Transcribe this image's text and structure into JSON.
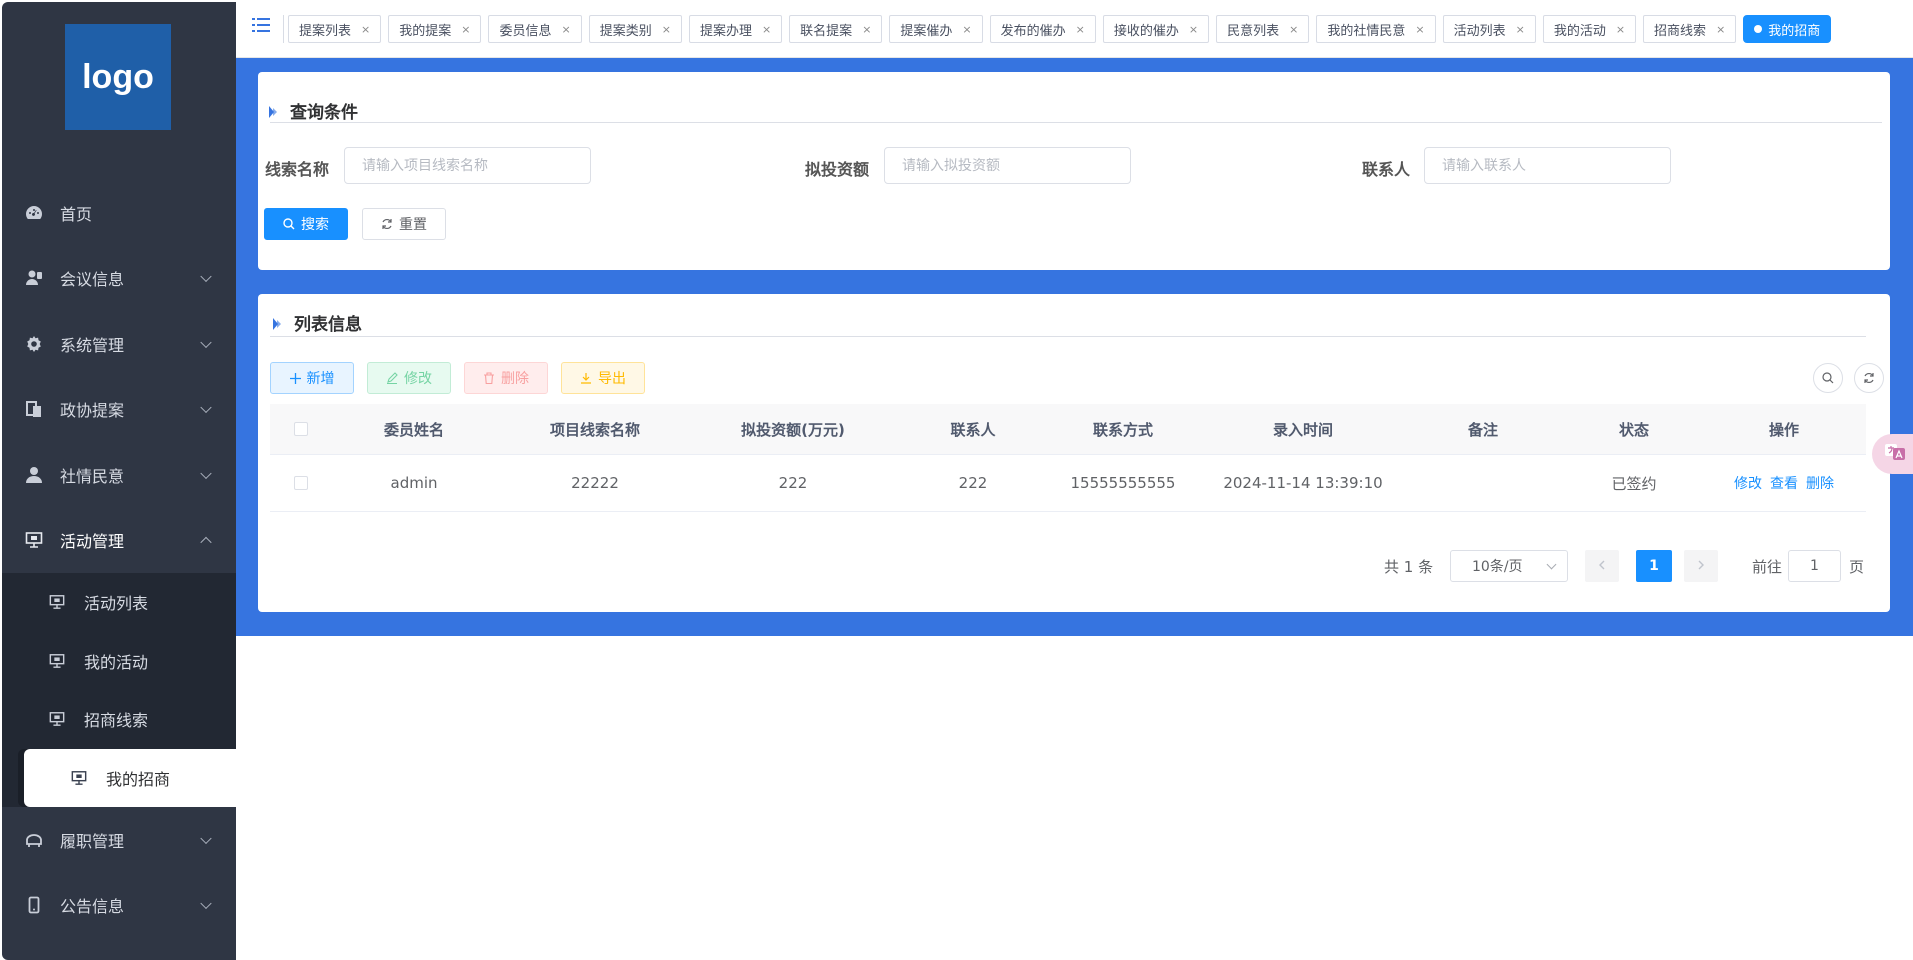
{
  "sidebar": {
    "logo": "logo",
    "items": [
      {
        "label": "首页",
        "icon": "dashboard-icon"
      },
      {
        "label": "会议信息",
        "icon": "meeting-icon"
      },
      {
        "label": "系统管理",
        "icon": "gear-icon"
      },
      {
        "label": "政协提案",
        "icon": "document-icon"
      },
      {
        "label": "社情民意",
        "icon": "user-icon"
      },
      {
        "label": "活动管理",
        "icon": "monitor-icon"
      }
    ],
    "sub_items": [
      {
        "label": "活动列表"
      },
      {
        "label": "我的活动"
      },
      {
        "label": "招商线索"
      },
      {
        "label": "我的招商"
      }
    ],
    "bottom_items": [
      {
        "label": "履职管理",
        "icon": "duty-icon"
      },
      {
        "label": "公告信息",
        "icon": "phone-icon"
      }
    ]
  },
  "tagbar": {
    "tags": [
      "提案列表",
      "我的提案",
      "委员信息",
      "提案类别",
      "提案办理",
      "联名提案",
      "提案催办",
      "发布的催办",
      "接收的催办",
      "民意列表",
      "我的社情民意",
      "活动列表",
      "我的活动",
      "招商线索"
    ],
    "active_tag": "我的招商"
  },
  "query": {
    "title": "查询条件",
    "fields": [
      {
        "label": "线索名称",
        "placeholder": "请输入项目线索名称"
      },
      {
        "label": "拟投资额",
        "placeholder": "请输入拟投资额"
      },
      {
        "label": "联系人",
        "placeholder": "请输入联系人"
      }
    ],
    "search_label": "搜索",
    "reset_label": "重置"
  },
  "list": {
    "title": "列表信息",
    "add_label": "新增",
    "edit_label": "修改",
    "delete_label": "删除",
    "export_label": "导出",
    "columns": [
      "委员姓名",
      "项目线索名称",
      "拟投资额(万元)",
      "联系人",
      "联系方式",
      "录入时间",
      "备注",
      "状态",
      "操作"
    ],
    "rows": [
      {
        "name": "admin",
        "project": "22222",
        "amount": "222",
        "contact": "222",
        "phone": "15555555555",
        "time": "2024-11-14 13:39:10",
        "remark": "",
        "status": "已签约"
      }
    ],
    "row_actions": [
      "修改",
      "查看",
      "删除"
    ]
  },
  "pagination": {
    "total": "共 1 条",
    "page_size": "10条/页",
    "current": "1",
    "goto_label": "前往",
    "goto_value": "1",
    "page_suffix": "页"
  },
  "colors": {
    "sidebar_bg": "#2f3644",
    "main_bg": "#3674e0",
    "primary": "#1890ff"
  }
}
